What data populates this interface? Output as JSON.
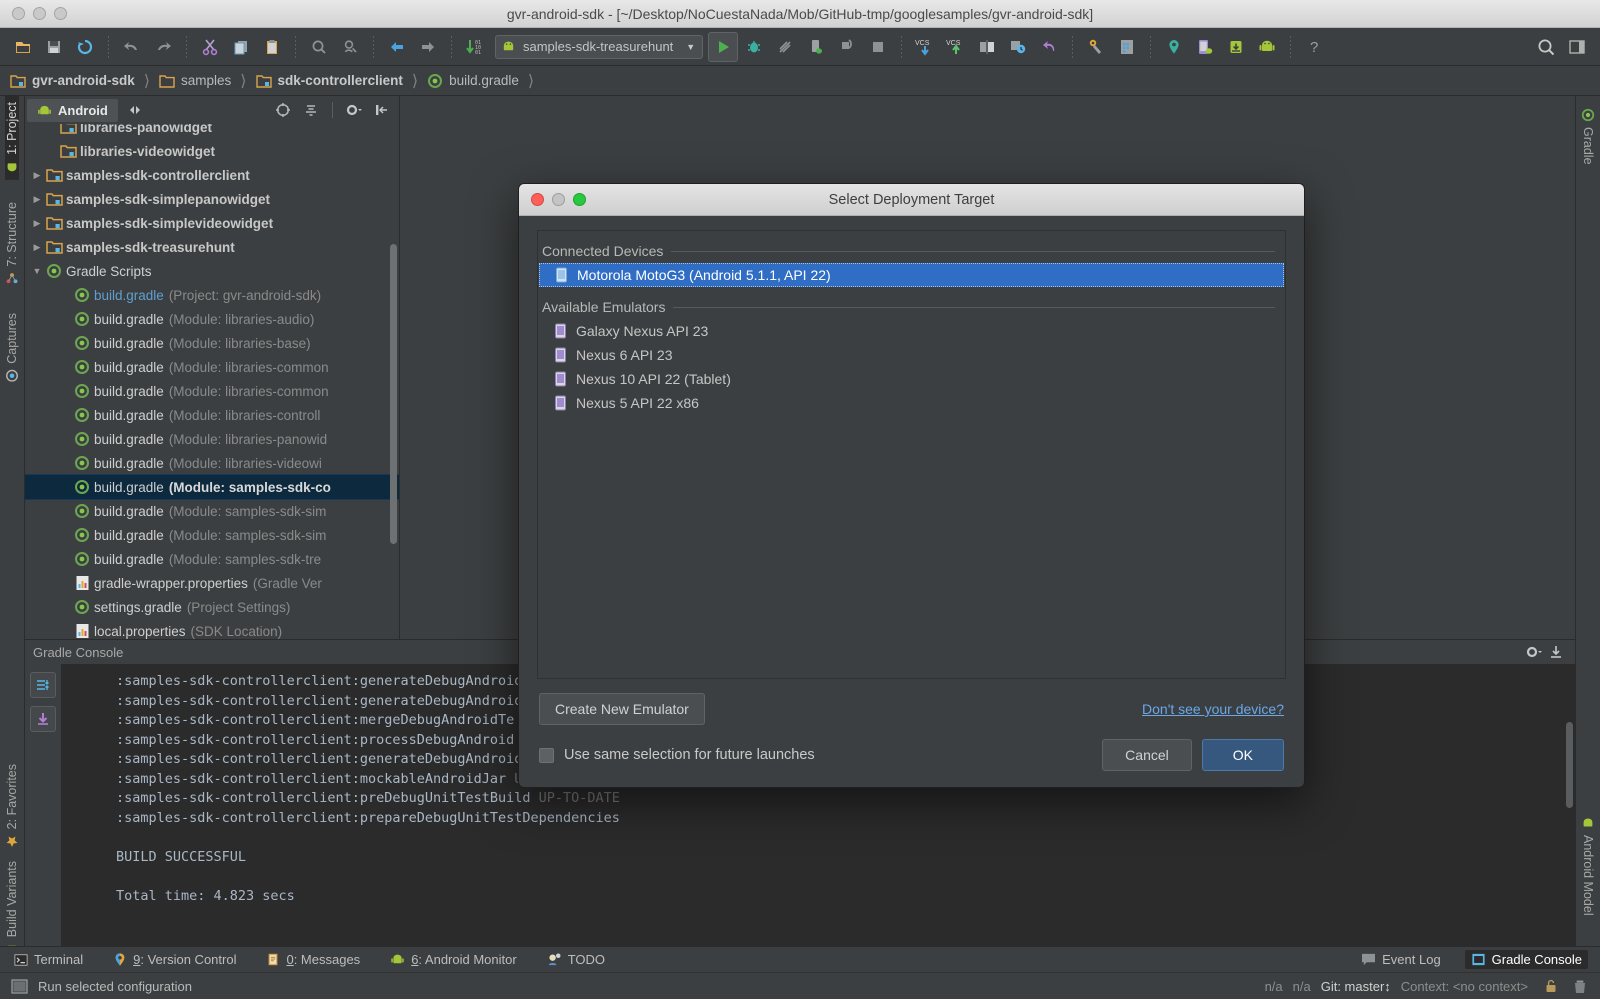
{
  "window": {
    "title": "gvr-android-sdk - [~/Desktop/NoCuestaNada/Mob/GitHub-tmp/googlesamples/gvr-android-sdk]"
  },
  "toolbar": {
    "run_config": "samples-sdk-treasurehunt",
    "icons": [
      "open-folder-icon",
      "save-all-icon",
      "sync-icon",
      "undo-icon",
      "redo-icon",
      "cut-icon",
      "copy-icon",
      "paste-icon",
      "find-icon",
      "find-usages-icon",
      "back-icon",
      "forward-icon",
      "compile-icon"
    ],
    "right_icons": [
      "run-icon",
      "debug-icon",
      "coverage-icon",
      "attach-debugger-icon",
      "rerun-icon",
      "stop-icon",
      "vcs-update-icon",
      "vcs-commit-icon",
      "diff-icon",
      "history-icon",
      "revert-icon",
      "settings-icon",
      "project-structure-icon",
      "sdk-manager-icon",
      "avd-manager-icon",
      "sdk-download-icon",
      "android-icon",
      "help-icon",
      "search-everywhere-icon",
      "layout-icon"
    ]
  },
  "breadcrumb": [
    {
      "label": "gvr-android-sdk",
      "icon": "module-folder-icon",
      "bold": true
    },
    {
      "label": "samples",
      "icon": "folder-icon",
      "bold": false
    },
    {
      "label": "sdk-controllerclient",
      "icon": "module-folder-icon",
      "bold": true
    },
    {
      "label": "build.gradle",
      "icon": "gradle-icon",
      "bold": false
    }
  ],
  "left_strip": {
    "top": [
      {
        "label": "1: Project",
        "icon": "android-icon",
        "active": true
      },
      {
        "label": "7: Structure",
        "icon": "structure-icon",
        "active": false
      },
      {
        "label": "Captures",
        "icon": "captures-icon",
        "active": false
      }
    ],
    "bottom": [
      {
        "label": "2: Favorites",
        "icon": "star-icon",
        "active": false
      },
      {
        "label": "Build Variants",
        "icon": "android-icon",
        "active": false
      }
    ]
  },
  "right_strip": {
    "top": [
      {
        "label": "Gradle",
        "icon": "gradle-icon"
      }
    ],
    "bottom": [
      {
        "label": "Android Model",
        "icon": "android-icon"
      }
    ]
  },
  "project_panel": {
    "tab_label": "Android",
    "header_icons": [
      "target-icon",
      "collapse-all-icon",
      "settings-gear-icon",
      "hide-icon"
    ],
    "tree": [
      {
        "arrow": "",
        "icon": "module-folder-icon",
        "name": "libraries-panowidget",
        "sub": "",
        "indent": 1,
        "style": "bold",
        "clipped": true
      },
      {
        "arrow": "",
        "icon": "module-folder-icon",
        "name": "libraries-videowidget",
        "sub": "",
        "indent": 1,
        "style": "bold"
      },
      {
        "arrow": "▶",
        "icon": "module-folder-icon",
        "name": "samples-sdk-controllerclient",
        "sub": "",
        "indent": 0,
        "style": "bold"
      },
      {
        "arrow": "▶",
        "icon": "module-folder-icon",
        "name": "samples-sdk-simplepanowidget",
        "sub": "",
        "indent": 0,
        "style": "bold"
      },
      {
        "arrow": "▶",
        "icon": "module-folder-icon",
        "name": "samples-sdk-simplevideowidget",
        "sub": "",
        "indent": 0,
        "style": "bold"
      },
      {
        "arrow": "▶",
        "icon": "module-folder-icon",
        "name": "samples-sdk-treasurehunt",
        "sub": "",
        "indent": 0,
        "style": "bold"
      },
      {
        "arrow": "▼",
        "icon": "gradle-icon",
        "name": "Gradle Scripts",
        "sub": "",
        "indent": 0,
        "style": "plain"
      },
      {
        "arrow": "",
        "icon": "gradle-icon",
        "name": "build.gradle",
        "sub": "(Project: gvr-android-sdk)",
        "indent": 2,
        "style": "blue"
      },
      {
        "arrow": "",
        "icon": "gradle-icon",
        "name": "build.gradle",
        "sub": "(Module: libraries-audio)",
        "indent": 2,
        "style": "plain"
      },
      {
        "arrow": "",
        "icon": "gradle-icon",
        "name": "build.gradle",
        "sub": "(Module: libraries-base)",
        "indent": 2,
        "style": "plain"
      },
      {
        "arrow": "",
        "icon": "gradle-icon",
        "name": "build.gradle",
        "sub": "(Module: libraries-common",
        "indent": 2,
        "style": "plain"
      },
      {
        "arrow": "",
        "icon": "gradle-icon",
        "name": "build.gradle",
        "sub": "(Module: libraries-common",
        "indent": 2,
        "style": "plain"
      },
      {
        "arrow": "",
        "icon": "gradle-icon",
        "name": "build.gradle",
        "sub": "(Module: libraries-controll",
        "indent": 2,
        "style": "plain"
      },
      {
        "arrow": "",
        "icon": "gradle-icon",
        "name": "build.gradle",
        "sub": "(Module: libraries-panowid",
        "indent": 2,
        "style": "plain"
      },
      {
        "arrow": "",
        "icon": "gradle-icon",
        "name": "build.gradle",
        "sub": "(Module: libraries-videowi",
        "indent": 2,
        "style": "plain"
      },
      {
        "arrow": "",
        "icon": "gradle-icon",
        "name": "build.gradle",
        "sub": "(Module: samples-sdk-co",
        "indent": 2,
        "style": "plain",
        "selected": true
      },
      {
        "arrow": "",
        "icon": "gradle-icon",
        "name": "build.gradle",
        "sub": "(Module: samples-sdk-sim",
        "indent": 2,
        "style": "plain"
      },
      {
        "arrow": "",
        "icon": "gradle-icon",
        "name": "build.gradle",
        "sub": "(Module: samples-sdk-sim",
        "indent": 2,
        "style": "plain"
      },
      {
        "arrow": "",
        "icon": "gradle-icon",
        "name": "build.gradle",
        "sub": "(Module: samples-sdk-tre",
        "indent": 2,
        "style": "plain"
      },
      {
        "arrow": "",
        "icon": "properties-icon",
        "name": "gradle-wrapper.properties",
        "sub": "(Gradle Ver",
        "indent": 2,
        "style": "plain"
      },
      {
        "arrow": "",
        "icon": "gradle-icon",
        "name": "settings.gradle",
        "sub": "(Project Settings)",
        "indent": 2,
        "style": "plain"
      },
      {
        "arrow": "",
        "icon": "properties-icon",
        "name": "local.properties",
        "sub": "(SDK Location)",
        "indent": 2,
        "style": "plain"
      }
    ]
  },
  "console": {
    "title": "Gradle Console",
    "side_icons": [
      "toggle-tasks-icon",
      "scroll-to-end-icon"
    ],
    "gear_icon": "settings-gear-icon",
    "export_icon": "export-icon",
    "lines": [
      {
        "text": ":samples-sdk-controllerclient:generateDebugAndroid",
        "suffix": ""
      },
      {
        "text": ":samples-sdk-controllerclient:generateDebugAndroid",
        "suffix": ""
      },
      {
        "text": ":samples-sdk-controllerclient:mergeDebugAndroidTe",
        "suffix": ""
      },
      {
        "text": ":samples-sdk-controllerclient:processDebugAndroid",
        "suffix": ""
      },
      {
        "text": ":samples-sdk-controllerclient:generateDebugAndroid",
        "suffix": ""
      },
      {
        "text": ":samples-sdk-controllerclient:mockableAndroidJar ",
        "suffix": "UP-TO-DATE"
      },
      {
        "text": ":samples-sdk-controllerclient:preDebugUnitTestBuild ",
        "suffix": "UP-TO-DATE"
      },
      {
        "text": ":samples-sdk-controllerclient:prepareDebugUnitTestDependencies",
        "suffix": ""
      },
      {
        "text": "",
        "suffix": ""
      },
      {
        "text": "BUILD SUCCESSFUL",
        "suffix": ""
      },
      {
        "text": "",
        "suffix": ""
      },
      {
        "text": "Total time: 4.823 secs",
        "suffix": ""
      }
    ]
  },
  "bottom_tabs": {
    "left": [
      {
        "label": "Terminal",
        "icon": "terminal-icon",
        "mnemonic": ""
      },
      {
        "label": ": Version Control",
        "icon": "vcs-icon",
        "mnemonic": "9"
      },
      {
        "label": ": Messages",
        "icon": "messages-icon",
        "mnemonic": "0"
      },
      {
        "label": ": Android Monitor",
        "icon": "android-icon",
        "mnemonic": "6"
      },
      {
        "label": "TODO",
        "icon": "todo-icon",
        "mnemonic": ""
      }
    ],
    "right": [
      {
        "label": "Event Log",
        "icon": "event-log-icon",
        "active": false
      },
      {
        "label": "Gradle Console",
        "icon": "gradle-console-icon",
        "active": true
      }
    ]
  },
  "statusbar": {
    "message": "Run selected configuration",
    "message_icon": "terminal-square-icon",
    "position1": "n/a",
    "position2": "n/a",
    "git_label": "Git: master",
    "context": "Context: <no context>",
    "lock_icon": "lock-icon",
    "memory_icon": "trash-icon"
  },
  "dialog": {
    "title": "Select Deployment Target",
    "traffic": {
      "close": "#ff5f57",
      "minimize": "#c4c4c4",
      "zoom": "#28c840"
    },
    "groups": [
      {
        "label": "Connected Devices",
        "devices": [
          {
            "name": "Motorola MotoG3 (Android 5.1.1, API 22)",
            "icon": "device-phone-icon",
            "selected": true
          }
        ]
      },
      {
        "label": "Available Emulators",
        "devices": [
          {
            "name": "Galaxy Nexus API 23",
            "icon": "emulator-phone-icon",
            "selected": false
          },
          {
            "name": "Nexus 6 API 23",
            "icon": "emulator-phone-icon",
            "selected": false
          },
          {
            "name": "Nexus 10 API 22 (Tablet)",
            "icon": "emulator-phone-icon",
            "selected": false
          },
          {
            "name": "Nexus 5 API 22 x86",
            "icon": "emulator-phone-icon",
            "selected": false
          }
        ]
      }
    ],
    "create_emulator_label": "Create New Emulator",
    "help_link": "Don't see your device?",
    "checkbox_label": "Use same selection for future launches",
    "cancel_label": "Cancel",
    "ok_label": "OK",
    "accent": "#2f6ec4"
  }
}
